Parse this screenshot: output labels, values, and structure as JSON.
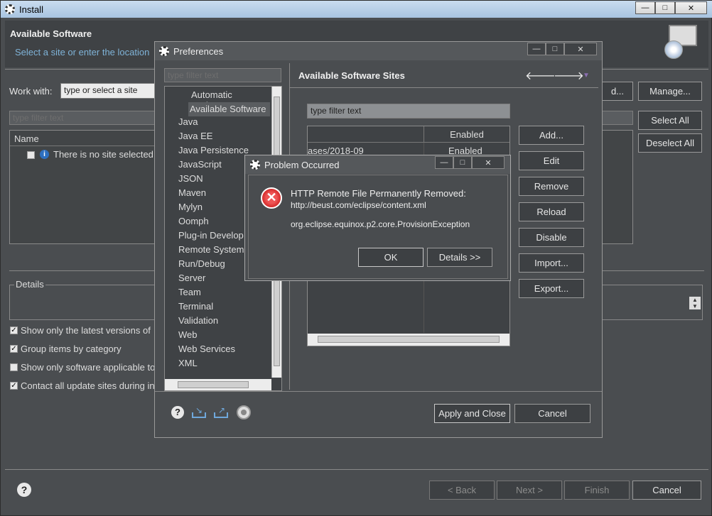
{
  "install": {
    "title": "Install",
    "header": "Available Software",
    "subheader": "Select a site or enter the location",
    "work_with_label": "Work with:",
    "work_with_placeholder": "type or select a site",
    "filter_placeholder": "type filter text",
    "name_column": "Name",
    "no_site_message": "There is no site selected",
    "details_label": "Details",
    "manage_button": "Manage...",
    "select_all_button": "Select All",
    "deselect_all_button": "Deselect All",
    "options": [
      {
        "label": "Show only the latest versions of",
        "checked": true
      },
      {
        "label": "Group items by category",
        "checked": true
      },
      {
        "label": "Show only software applicable to",
        "checked": false
      },
      {
        "label": "Contact all update sites during in",
        "checked": true
      }
    ],
    "footer": {
      "back": "< Back",
      "next": "Next >",
      "finish": "Finish",
      "cancel": "Cancel"
    }
  },
  "preferences": {
    "title": "Preferences",
    "filter_placeholder": "type filter text",
    "tree_items": [
      "Automatic Updates",
      "Available Software",
      "Java",
      "Java EE",
      "Java Persistence",
      "JavaScript",
      "JSON",
      "Maven",
      "Mylyn",
      "Oomph",
      "Plug-in Develop",
      "Remote Systems",
      "Run/Debug",
      "Server",
      "Team",
      "Terminal",
      "Validation",
      "Web",
      "Web Services",
      "XML"
    ],
    "page_title": "Available Software Sites",
    "sites_filter_placeholder": "type filter text",
    "enabled_column": "Enabled",
    "site_row": {
      "location": "ases/2018-09",
      "enabled": "Enabled"
    },
    "buttons": {
      "add": "Add...",
      "edit": "Edit",
      "remove": "Remove",
      "reload": "Reload",
      "disable": "Disable",
      "import": "Import...",
      "export": "Export..."
    },
    "apply_close": "Apply and Close",
    "cancel": "Cancel"
  },
  "problem": {
    "title": "Problem Occurred",
    "message_line1": "HTTP Remote File Permanently Removed:",
    "message_line2": "http://beust.com/eclipse/content.xml",
    "exception": "org.eclipse.equinox.p2.core.ProvisionException",
    "ok": "OK",
    "details": "Details >>"
  }
}
